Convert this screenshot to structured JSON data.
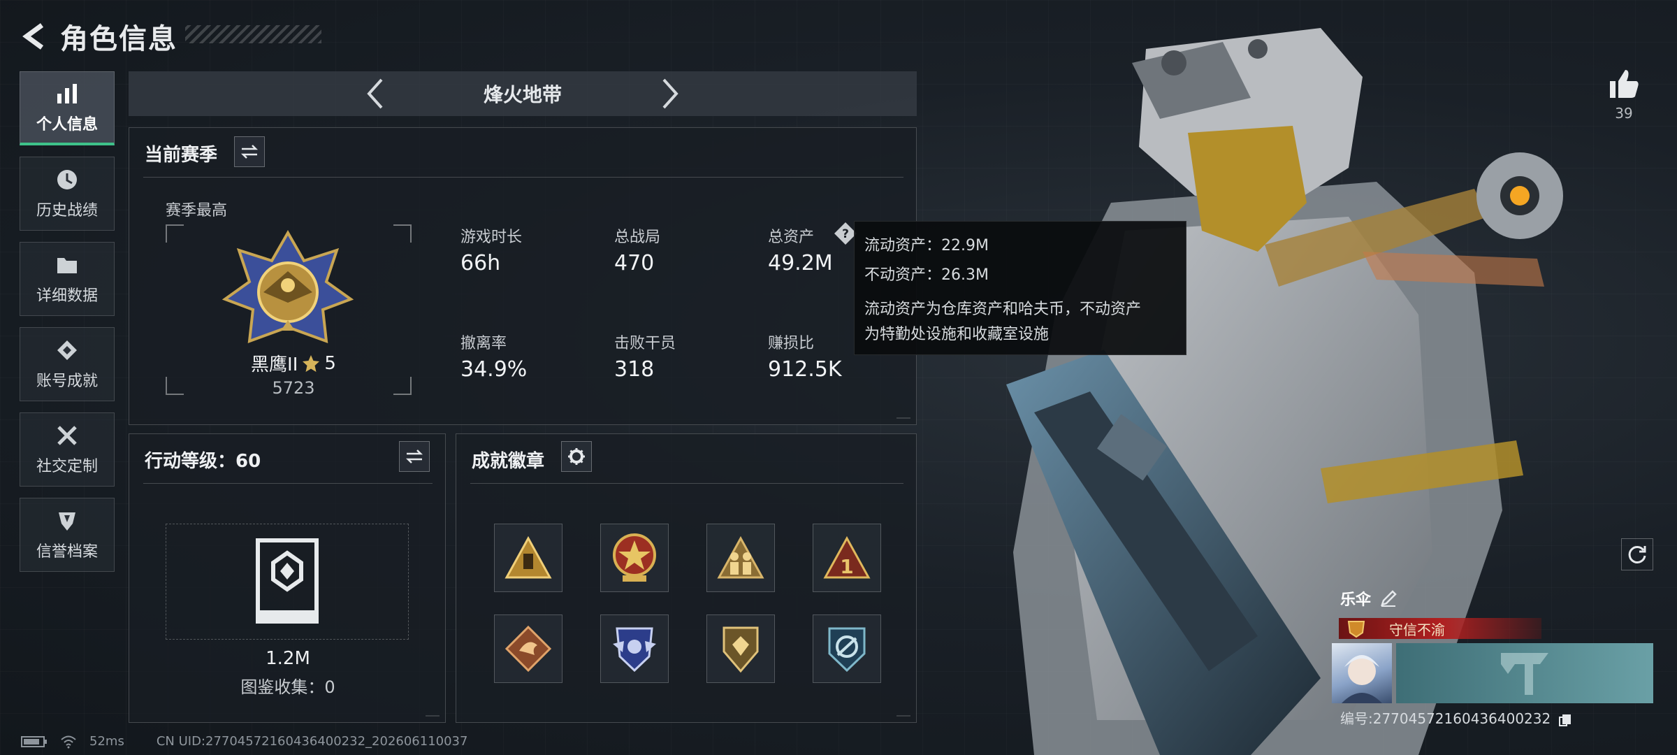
{
  "header": {
    "title": "角色信息"
  },
  "nav": [
    {
      "label": "个人信息",
      "icon": "bar-chart-icon",
      "active": true
    },
    {
      "label": "历史战绩",
      "icon": "clock-icon",
      "active": false
    },
    {
      "label": "详细数据",
      "icon": "folder-icon",
      "active": false
    },
    {
      "label": "账号成就",
      "icon": "achievement-icon",
      "active": false
    },
    {
      "label": "社交定制",
      "icon": "tools-icon",
      "active": false
    },
    {
      "label": "信誉档案",
      "icon": "shield-icon",
      "active": false
    }
  ],
  "mode": {
    "name": "烽火地带"
  },
  "season": {
    "title": "当前赛季",
    "best_label": "赛季最高",
    "rank_name": "黑鹰II",
    "rank_stars": "5",
    "rank_score": "5723",
    "stats": [
      {
        "label": "游戏时长",
        "value": "66h"
      },
      {
        "label": "总战局",
        "value": "470"
      },
      {
        "label": "总资产",
        "value": "49.2M"
      },
      {
        "label": "撤离率",
        "value": "34.9%"
      },
      {
        "label": "击败干员",
        "value": "318"
      },
      {
        "label": "赚损比",
        "value": "912.5K"
      }
    ]
  },
  "tooltip": {
    "liquid": "流动资产：22.9M",
    "fixed": "不动资产：26.3M",
    "desc_line1": "流动资产为仓库资产和哈夫币，不动资产",
    "desc_line2": "为特勤处设施和收藏室设施"
  },
  "action_level": {
    "title": "行动等级：60",
    "value": "1.2M",
    "collection": "图鉴收集：0"
  },
  "badges": {
    "title": "成就徽章",
    "items": [
      "triangle-badge",
      "star-medal-badge",
      "soldiers-badge",
      "number-one-badge",
      "dragon-badge",
      "shield-wings-badge",
      "gem-shield-badge",
      "emblem-badge"
    ]
  },
  "profile": {
    "likes": "39",
    "nickname": "乐伞",
    "honor_title": "守信不渝",
    "id_text": "编号:27704572160436400232"
  },
  "status": {
    "ping": "52ms",
    "uid": "CN UID:27704572160436400232_202606110037"
  },
  "colors": {
    "accent": "#3ec28a",
    "honor_red": "#b02020",
    "banner_teal": "#5a8e96"
  }
}
